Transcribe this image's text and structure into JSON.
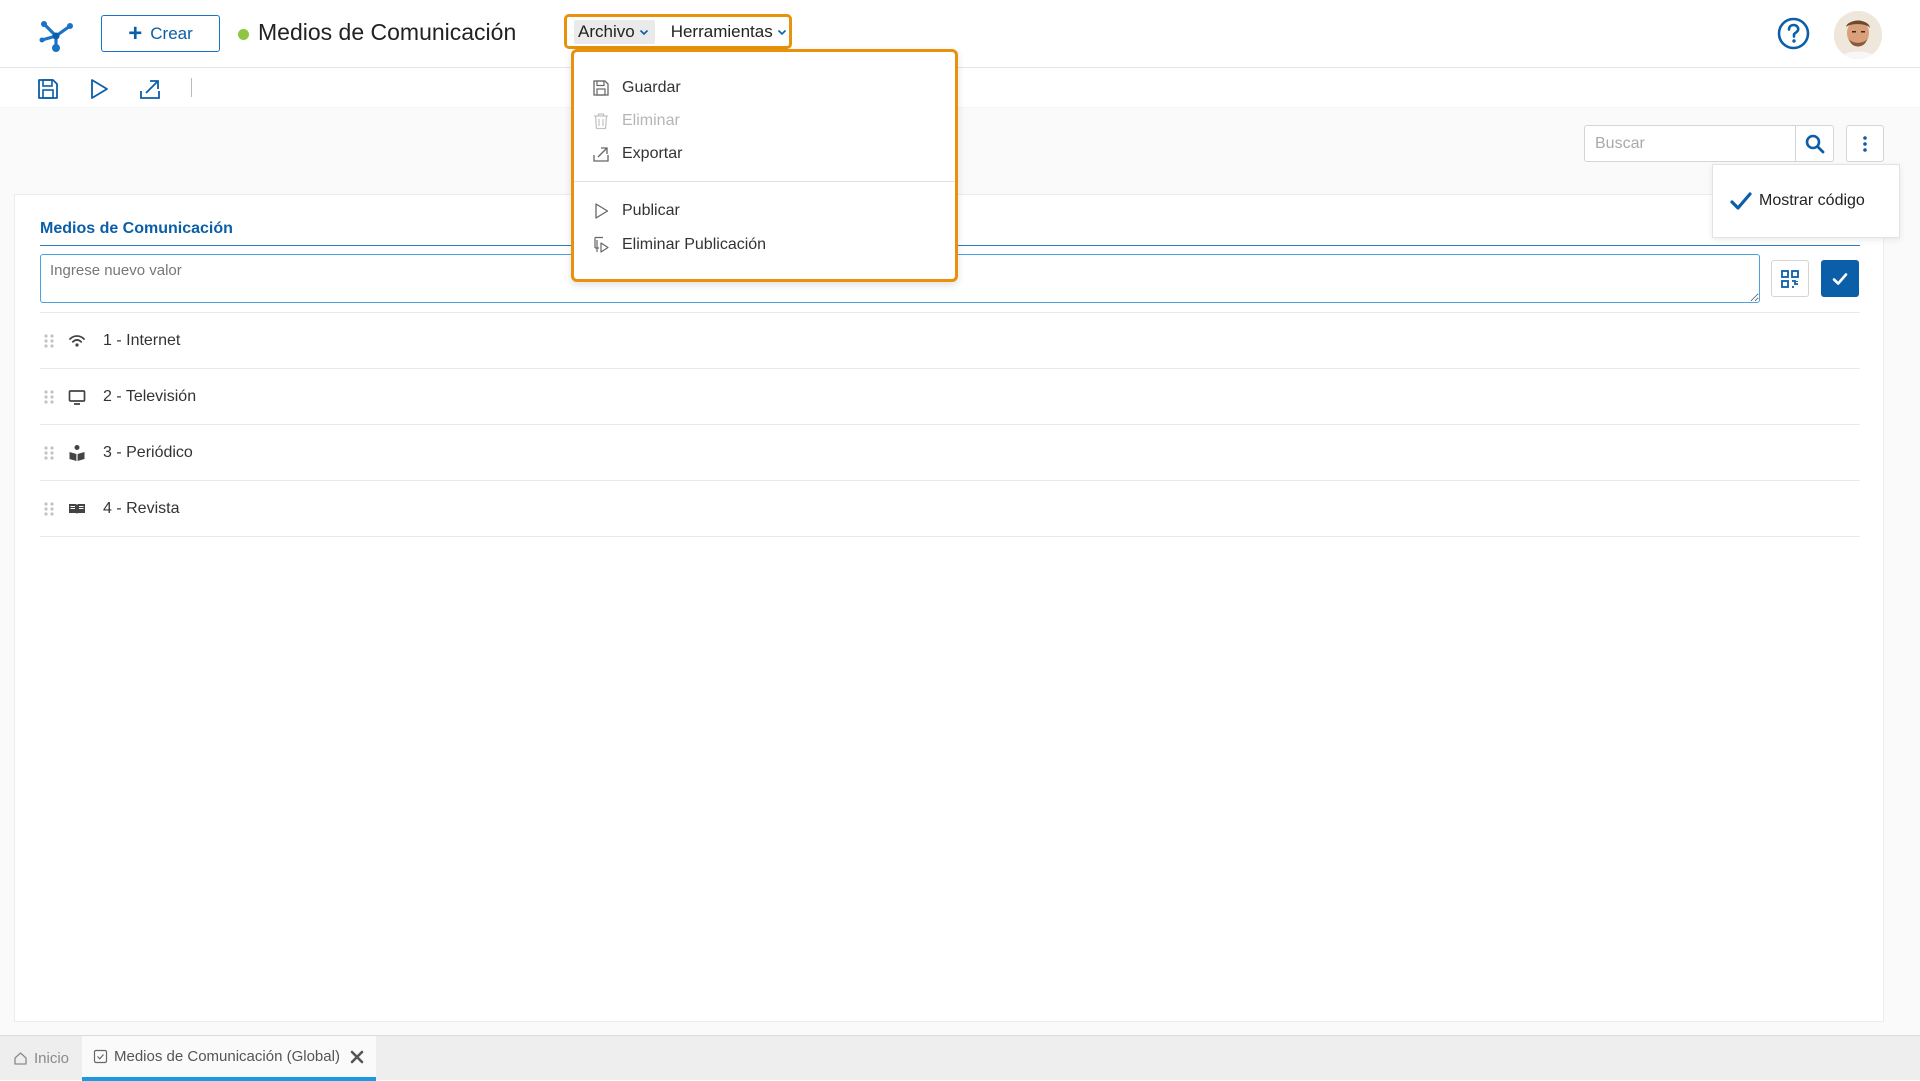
{
  "header": {
    "create_label": "Crear",
    "title": "Medios de Comunicación",
    "status_color": "#8dc63f",
    "menus": {
      "archivo": "Archivo",
      "herramientas": "Herramientas"
    }
  },
  "toolbar": {
    "icons": [
      "save-icon",
      "publish-icon",
      "export-icon"
    ]
  },
  "archivo_menu": {
    "items": [
      {
        "label": "Guardar",
        "icon": "save-icon",
        "enabled": true
      },
      {
        "label": "Eliminar",
        "icon": "trash-icon",
        "enabled": false
      },
      {
        "label": "Exportar",
        "icon": "export-icon",
        "enabled": true
      },
      {
        "label": "Publicar",
        "icon": "publish-icon",
        "enabled": true
      },
      {
        "label": "Eliminar Publicación",
        "icon": "unpublish-icon",
        "enabled": true
      }
    ]
  },
  "search": {
    "placeholder": "Buscar"
  },
  "options": {
    "show_code_label": "Mostrar código",
    "show_code_checked": true
  },
  "section": {
    "title": "Medios de Comunicación",
    "new_value_placeholder": "Ingrese nuevo valor"
  },
  "items": [
    {
      "label": "1 - Internet",
      "icon": "wifi-icon"
    },
    {
      "label": "2 - Televisión",
      "icon": "tv-icon"
    },
    {
      "label": "3 - Periódico",
      "icon": "newspaper-reader-icon"
    },
    {
      "label": "4 - Revista",
      "icon": "open-book-icon"
    }
  ],
  "tabs": [
    {
      "label": "Inicio",
      "icon": "home-icon",
      "active": false
    },
    {
      "label": "Medios de Comunicación (Global)",
      "icon": "list-check-icon",
      "active": true
    }
  ],
  "colors": {
    "primary": "#0b5ea8",
    "highlight": "#e8910c",
    "tab_underline": "#1a9be0"
  }
}
